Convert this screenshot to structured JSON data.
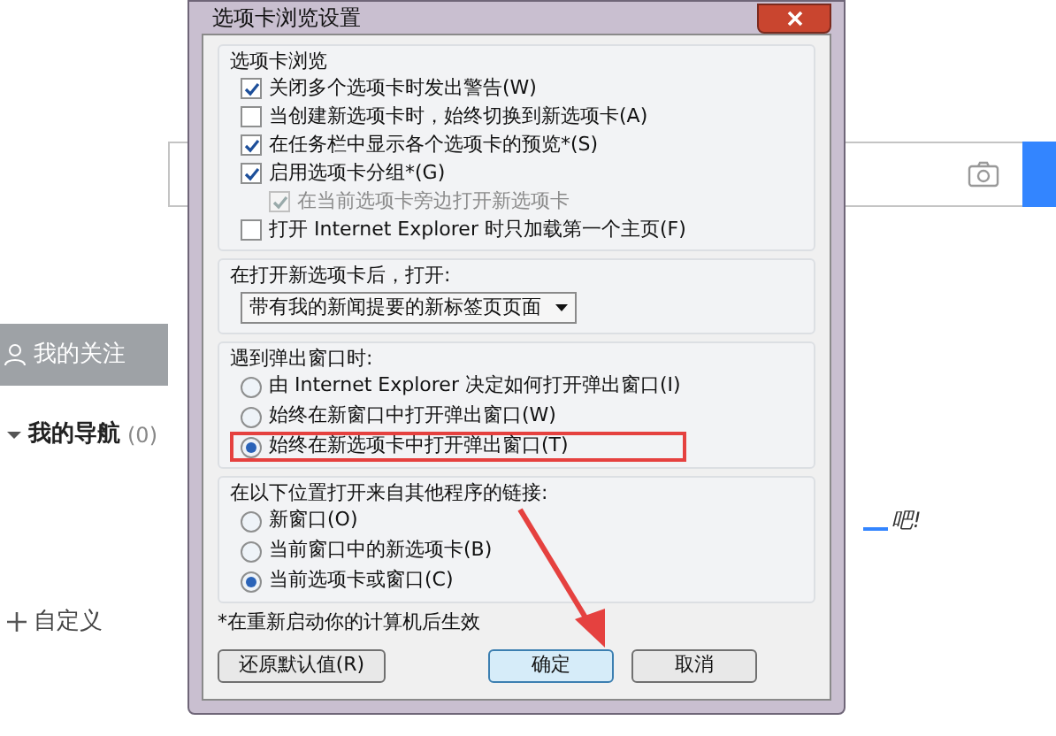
{
  "page": {
    "sidebar": {
      "follow": {
        "label": "我的关注",
        "selected": true
      },
      "nav": {
        "label": "我的导航",
        "count": "(0)",
        "expanded": true
      },
      "custom": {
        "label": "自定义"
      }
    },
    "hint_text": "吧!"
  },
  "dialog": {
    "title": "选项卡浏览设置",
    "tab_group": {
      "title": "选项卡浏览",
      "options": [
        {
          "label": "关闭多个选项卡时发出警告(W)",
          "checked": true,
          "disabled": false
        },
        {
          "label": "当创建新选项卡时，始终切换到新选项卡(A)",
          "checked": false,
          "disabled": false
        },
        {
          "label": "在任务栏中显示各个选项卡的预览*(S)",
          "checked": true,
          "disabled": false
        },
        {
          "label": "启用选项卡分组*(G)",
          "checked": true,
          "disabled": false,
          "children": [
            {
              "label": "在当前选项卡旁边打开新选项卡",
              "checked": true,
              "disabled": true
            }
          ]
        },
        {
          "label": "打开 Internet Explorer 时只加载第一个主页(F)",
          "checked": false,
          "disabled": false
        }
      ]
    },
    "new_tab": {
      "title": "在打开新选项卡后，打开:",
      "value": "带有我的新闻提要的新标签页页面"
    },
    "popup_group": {
      "title": "遇到弹出窗口时:",
      "options": [
        {
          "label": "由 Internet Explorer 决定如何打开弹出窗口(I)",
          "selected": false,
          "highlighted": false
        },
        {
          "label": "始终在新窗口中打开弹出窗口(W)",
          "selected": false,
          "highlighted": false
        },
        {
          "label": "始终在新选项卡中打开弹出窗口(T)",
          "selected": true,
          "highlighted": true
        }
      ]
    },
    "links_group": {
      "title": "在以下位置打开来自其他程序的链接:",
      "options": [
        {
          "label": "新窗口(O)",
          "selected": false,
          "highlighted": false
        },
        {
          "label": "当前窗口中的新选项卡(B)",
          "selected": false,
          "highlighted": false
        },
        {
          "label": "当前选项卡或窗口(C)",
          "selected": true,
          "highlighted": false
        }
      ]
    },
    "note": "*在重新启动你的计算机后生效",
    "buttons": [
      {
        "label": "还原默认值(R)",
        "default": false
      },
      {
        "label": "确定",
        "default": true
      },
      {
        "label": "取消",
        "default": false
      }
    ]
  }
}
